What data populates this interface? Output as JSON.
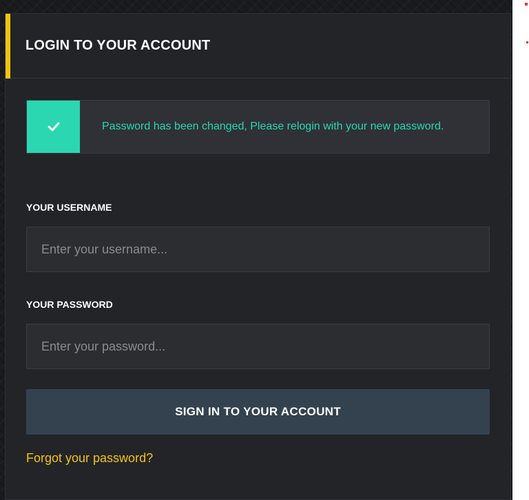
{
  "header": {
    "title": "LOGIN TO YOUR ACCOUNT"
  },
  "alert": {
    "icon": "check-icon",
    "message": "Password has been changed, Please relogin with your new password."
  },
  "username": {
    "label": "YOUR USERNAME",
    "placeholder": "Enter your username...",
    "value": ""
  },
  "password": {
    "label": "YOUR PASSWORD",
    "placeholder": "Enter your password...",
    "value": ""
  },
  "signin": {
    "label": "SIGN IN TO YOUR ACCOUNT"
  },
  "forgot": {
    "label": "Forgot your password?"
  },
  "colors": {
    "accent": "#f5c313",
    "success": "#2ad7b0",
    "button": "#34424f",
    "card": "#232428"
  }
}
